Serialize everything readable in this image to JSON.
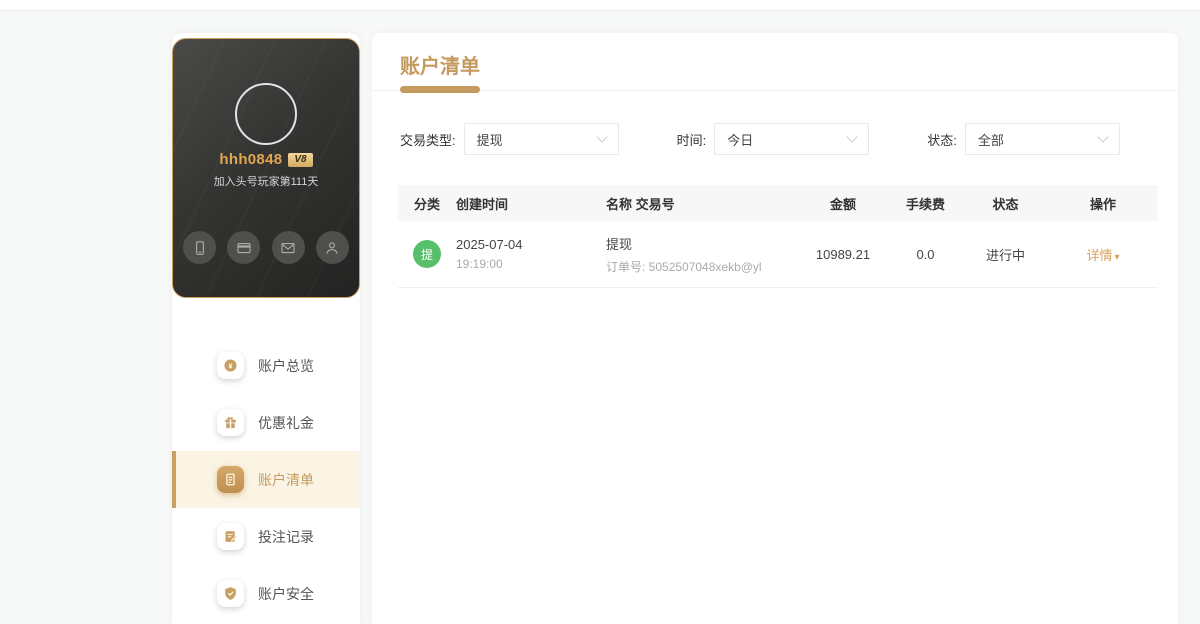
{
  "user_card": {
    "username": "hhh0848",
    "vip_badge": "V8",
    "join_text": "加入头号玩家第111天",
    "quick_icons": [
      "phone-icon",
      "bank-card-icon",
      "mail-icon",
      "profile-icon"
    ]
  },
  "sidebar": {
    "items": [
      {
        "label": "账户总览",
        "icon": "coin-icon",
        "active": false
      },
      {
        "label": "优惠礼金",
        "icon": "gift-icon",
        "active": false
      },
      {
        "label": "账户清单",
        "icon": "statement-icon",
        "active": true
      },
      {
        "label": "投注记录",
        "icon": "bet-record-icon",
        "active": false
      },
      {
        "label": "账户安全",
        "icon": "shield-icon",
        "active": false
      }
    ]
  },
  "main": {
    "title": "账户清单",
    "filters": [
      {
        "label": "交易类型:",
        "value": "提现"
      },
      {
        "label": "时间:",
        "value": "今日"
      },
      {
        "label": "状态:",
        "value": "全部"
      }
    ],
    "table": {
      "headers": [
        "分类",
        "创建时间",
        "名称 交易号",
        "金额",
        "手续费",
        "状态",
        "操作"
      ],
      "rows": [
        {
          "category_badge": "提",
          "date": "2025-07-04",
          "time": "19:19:00",
          "name": "提现",
          "order_no": "订单号: 5052507048xekb@yl",
          "amount": "10989.21",
          "fee": "0.0",
          "status": "进行中",
          "action": "详情"
        }
      ]
    }
  },
  "colors": {
    "accent_gold": "#c49a5f",
    "active_bg": "#fbf4e4",
    "badge_green": "#57bf6a",
    "action_link": "#dda159",
    "card_border": "#c9a05f"
  }
}
